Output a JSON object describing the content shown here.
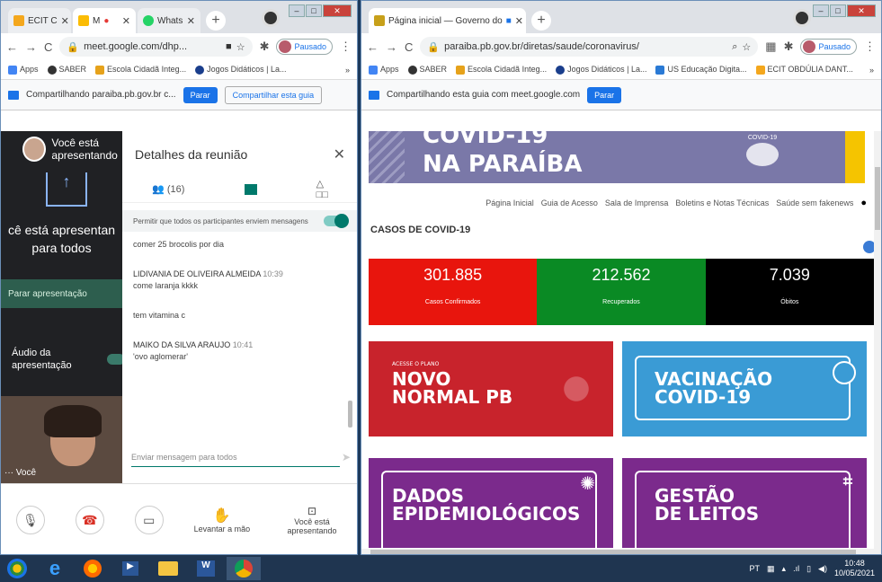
{
  "left_window": {
    "tabs": [
      {
        "label": "ECIT C",
        "color": "#f4a71d"
      },
      {
        "label": "M",
        "color": "#fbbc04"
      },
      {
        "label": "Whats",
        "color": "#25d366"
      }
    ],
    "url": "meet.google.com/dhp...",
    "paused_label": "Pausado",
    "bookmarks": [
      "Apps",
      "SABER",
      "Escola Cidadã Integ...",
      "Jogos Didáticos | La..."
    ],
    "bookmarks_more": "»",
    "share_text": "Compartilhando paraiba.pb.gov.br c...",
    "share_stop": "Parar",
    "share_this_tab": "Compartilhar esta guia",
    "presenting_user": "Você está apresentando",
    "presenting_big": "cê está apresentan para todos",
    "stop_presenting": "Parar apresentação",
    "audio_label": "Áudio da apresentação",
    "self_label": "Você",
    "panel": {
      "title": "Detalhes da reunião",
      "people_count": "(16)",
      "allow_text": "Permitir que todos os participantes enviem mensagens",
      "messages": [
        {
          "author": "",
          "time": "",
          "text": "comer 25 brocolis por dia"
        },
        {
          "author": "LIDIVANIA DE OLIVEIRA ALMEIDA",
          "time": "10:39",
          "text": "come laranja kkkk"
        },
        {
          "author": "",
          "time": "",
          "text": "tem vitamina c"
        },
        {
          "author": "MAIKO DA SILVA ARAUJO",
          "time": "10:41",
          "text": "'ovo aglomerar'"
        }
      ],
      "input_placeholder": "Enviar mensagem para todos"
    },
    "controls": {
      "raise_hand": "Levantar a mão",
      "presenting": "Você está apresentando"
    }
  },
  "right_window": {
    "tab_label": "Página inicial — Governo do",
    "url": "paraiba.pb.gov.br/diretas/saude/coronavirus/",
    "paused_label": "Pausado",
    "bookmarks": [
      "Apps",
      "SABER",
      "Escola Cidadã Integ...",
      "Jogos Didáticos | La...",
      "US Educação Digita...",
      "ECIT OBDÚLIA DANT..."
    ],
    "bookmarks_more": "»",
    "share_text": "Compartilhando esta guia com meet.google.com",
    "share_stop": "Parar",
    "banner_line1": "COVID-19",
    "banner_line2": "NA PARAÍBA",
    "banner_logo_text": "COVID-19",
    "nav": [
      "Página Inicial",
      "Guia de Acesso",
      "Sala de Imprensa",
      "Boletins e Notas Técnicas",
      "Saúde sem fakenews"
    ],
    "cases_title": "CASOS DE COVID-19",
    "stats": [
      {
        "value": "301.885",
        "label": "Casos Confirmados",
        "color": "#e8150d"
      },
      {
        "value": "212.562",
        "label": "Recuperados",
        "color": "#0a8a24"
      },
      {
        "value": "7.039",
        "label": "Óbitos",
        "color": "#000000"
      }
    ],
    "cards": [
      {
        "small": "ACESSE O PLANO",
        "line1": "NOVO",
        "line2": "NORMAL PB",
        "color": "#c8232c"
      },
      {
        "line1": "VACINAÇÃO",
        "line2": "COVID-19",
        "color": "#3a9bd5"
      },
      {
        "line1": "DADOS",
        "line2": "EPIDEMIOLÓGICOS",
        "color": "#7b2a8c"
      },
      {
        "line1": "GESTÃO",
        "line2": "DE LEITOS",
        "color": "#7b2a8c"
      }
    ]
  },
  "taskbar": {
    "lang": "PT",
    "time": "10:48",
    "date": "10/05/2021"
  }
}
